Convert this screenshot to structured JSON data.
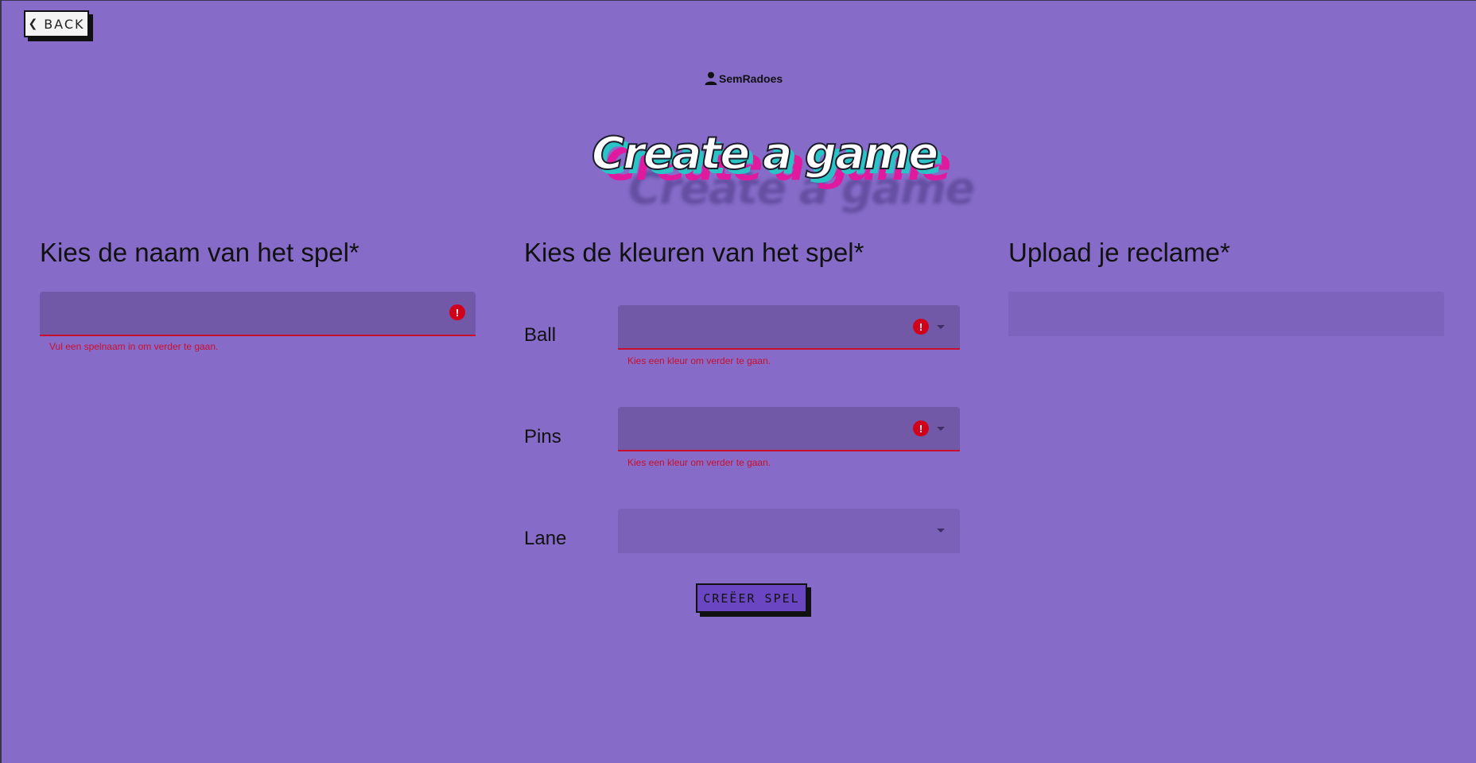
{
  "nav": {
    "back_label": "BACK"
  },
  "user": {
    "name": "SemRadoes"
  },
  "title": "Create a game",
  "name_section": {
    "heading": "Kies de naam van het spel*",
    "value": "",
    "error": "Vul een spelnaam in om verder te gaan."
  },
  "colors_section": {
    "heading": "Kies de kleuren van het spel*",
    "rows": [
      {
        "label": "Ball",
        "value": "",
        "error": "Kies een kleur om verder te gaan."
      },
      {
        "label": "Pins",
        "value": "",
        "error": "Kies een kleur om verder te gaan."
      },
      {
        "label": "Lane",
        "value": "",
        "error": ""
      }
    ]
  },
  "upload_section": {
    "heading": "Upload je reclame*"
  },
  "submit_label": "CREËER SPEL",
  "colors": {
    "background": "#866cc8",
    "error": "#c8102e",
    "field": "#7259a8",
    "button": "#6a46c2"
  },
  "icons": [
    "chevron-left-icon",
    "user-icon",
    "error-icon",
    "dropdown-caret-icon"
  ]
}
